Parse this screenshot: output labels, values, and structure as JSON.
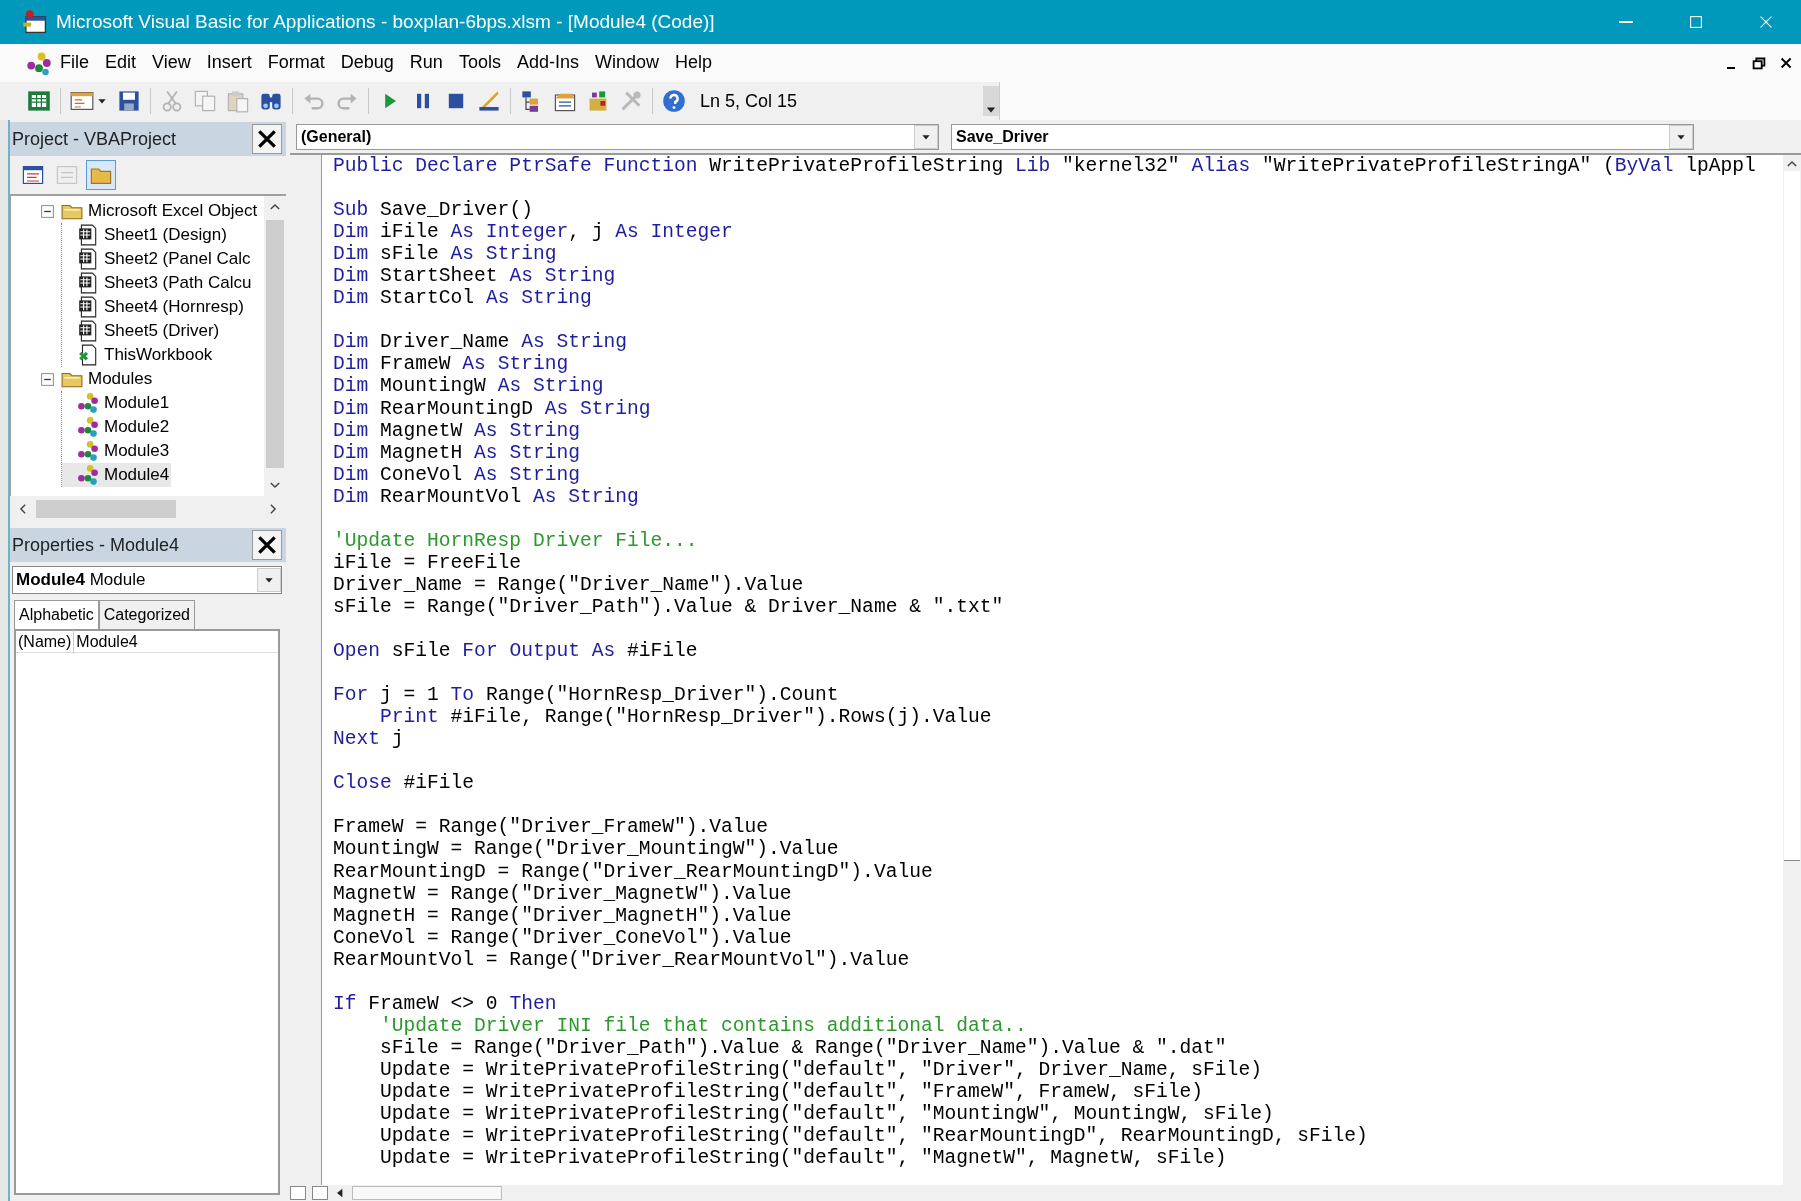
{
  "window": {
    "title": "Microsoft Visual Basic for Applications - boxplan-6bps.xlsm - [Module4 (Code)]"
  },
  "menu": [
    "File",
    "Edit",
    "View",
    "Insert",
    "Format",
    "Debug",
    "Run",
    "Tools",
    "Add-Ins",
    "Window",
    "Help"
  ],
  "toolbar": [
    {
      "kind": "excel",
      "disabled": false
    },
    {
      "kind": "separator"
    },
    {
      "kind": "userform",
      "disabled": false
    },
    {
      "kind": "save",
      "disabled": false
    },
    {
      "kind": "separator"
    },
    {
      "kind": "cut",
      "disabled": true
    },
    {
      "kind": "copy",
      "disabled": true
    },
    {
      "kind": "paste",
      "disabled": true
    },
    {
      "kind": "find",
      "disabled": false
    },
    {
      "kind": "separator"
    },
    {
      "kind": "undo",
      "disabled": true
    },
    {
      "kind": "redo",
      "disabled": true
    },
    {
      "kind": "separator"
    },
    {
      "kind": "run",
      "disabled": false
    },
    {
      "kind": "break",
      "disabled": false
    },
    {
      "kind": "reset",
      "disabled": false
    },
    {
      "kind": "design",
      "disabled": false
    },
    {
      "kind": "separator"
    },
    {
      "kind": "explorer",
      "disabled": false
    },
    {
      "kind": "properties",
      "disabled": false
    },
    {
      "kind": "browser",
      "disabled": false
    },
    {
      "kind": "toolbox",
      "disabled": true
    },
    {
      "kind": "separator"
    },
    {
      "kind": "help",
      "disabled": false
    }
  ],
  "cursor_position": "Ln 5, Col 15",
  "project": {
    "title": "Project - VBAProject",
    "toolbar": [
      {
        "kind": "view_code",
        "disabled": false,
        "pressed": false
      },
      {
        "kind": "view_object",
        "disabled": true,
        "pressed": false
      },
      {
        "kind": "toggle_folders",
        "disabled": false,
        "pressed": true
      }
    ],
    "tree": [
      {
        "label": "Microsoft Excel Object",
        "kind": "folder",
        "expanded": true,
        "selected": false,
        "children": [
          {
            "label": "Sheet1 (Design)",
            "kind": "sheet",
            "selected": false
          },
          {
            "label": "Sheet2 (Panel Calc",
            "kind": "sheet",
            "selected": false
          },
          {
            "label": "Sheet3 (Path Calcu",
            "kind": "sheet",
            "selected": false
          },
          {
            "label": "Sheet4 (Hornresp)",
            "kind": "sheet",
            "selected": false
          },
          {
            "label": "Sheet5 (Driver)",
            "kind": "sheet",
            "selected": false
          },
          {
            "label": "ThisWorkbook",
            "kind": "workbook",
            "selected": false
          }
        ]
      },
      {
        "label": "Modules",
        "kind": "folder",
        "expanded": true,
        "selected": false,
        "children": [
          {
            "label": "Module1",
            "kind": "module",
            "selected": false
          },
          {
            "label": "Module2",
            "kind": "module",
            "selected": false
          },
          {
            "label": "Module3",
            "kind": "module",
            "selected": false
          },
          {
            "label": "Module4",
            "kind": "module",
            "selected": true
          }
        ]
      }
    ]
  },
  "properties": {
    "title": "Properties - Module4",
    "object": "**Module4** Module",
    "tabs": [
      {
        "label": "Alphabetic",
        "selected": true
      },
      {
        "label": "Categorized",
        "selected": false
      }
    ],
    "rows": [
      {
        "name": "(Name)",
        "value": "Module4"
      }
    ]
  },
  "editor": {
    "object": "(General)",
    "procedure": "Save_Driver",
    "lines": [
      {
        "kind": "code",
        "segments": [
          {
            "kind": "keyword",
            "text": "Public Declare PtrSafe Function"
          },
          {
            "kind": "plain",
            "text": " WritePrivateProfileString "
          },
          {
            "kind": "keyword",
            "text": "Lib"
          },
          {
            "kind": "plain",
            "text": " \"kernel32\" "
          },
          {
            "kind": "keyword",
            "text": "Alias"
          },
          {
            "kind": "plain",
            "text": " \"WritePrivateProfileStringA\" ("
          },
          {
            "kind": "keyword",
            "text": "ByVal"
          },
          {
            "kind": "plain",
            "text": " lpAppl"
          }
        ]
      },
      {
        "kind": "blank"
      },
      {
        "kind": "code",
        "segments": [
          {
            "kind": "keyword",
            "text": "Sub"
          },
          {
            "kind": "plain",
            "text": " Save_Driver()"
          }
        ]
      },
      {
        "kind": "code",
        "segments": [
          {
            "kind": "keyword",
            "text": "Dim"
          },
          {
            "kind": "plain",
            "text": " iFile "
          },
          {
            "kind": "keyword",
            "text": "As Integer"
          },
          {
            "kind": "plain",
            "text": ", j "
          },
          {
            "kind": "keyword",
            "text": "As Integer"
          }
        ]
      },
      {
        "kind": "code",
        "segments": [
          {
            "kind": "keyword",
            "text": "Dim"
          },
          {
            "kind": "plain",
            "text": " sFile "
          },
          {
            "kind": "keyword",
            "text": "As String"
          }
        ]
      },
      {
        "kind": "code",
        "segments": [
          {
            "kind": "keyword",
            "text": "Dim"
          },
          {
            "kind": "plain",
            "text": " StartSheet "
          },
          {
            "kind": "keyword",
            "text": "As String"
          }
        ]
      },
      {
        "kind": "code",
        "segments": [
          {
            "kind": "keyword",
            "text": "Dim"
          },
          {
            "kind": "plain",
            "text": " StartCol "
          },
          {
            "kind": "keyword",
            "text": "As String"
          }
        ]
      },
      {
        "kind": "blank"
      },
      {
        "kind": "code",
        "segments": [
          {
            "kind": "keyword",
            "text": "Dim"
          },
          {
            "kind": "plain",
            "text": " Driver_Name "
          },
          {
            "kind": "keyword",
            "text": "As String"
          }
        ]
      },
      {
        "kind": "code",
        "segments": [
          {
            "kind": "keyword",
            "text": "Dim"
          },
          {
            "kind": "plain",
            "text": " FrameW "
          },
          {
            "kind": "keyword",
            "text": "As String"
          }
        ]
      },
      {
        "kind": "code",
        "segments": [
          {
            "kind": "keyword",
            "text": "Dim"
          },
          {
            "kind": "plain",
            "text": " MountingW "
          },
          {
            "kind": "keyword",
            "text": "As String"
          }
        ]
      },
      {
        "kind": "code",
        "segments": [
          {
            "kind": "keyword",
            "text": "Dim"
          },
          {
            "kind": "plain",
            "text": " RearMountingD "
          },
          {
            "kind": "keyword",
            "text": "As String"
          }
        ]
      },
      {
        "kind": "code",
        "segments": [
          {
            "kind": "keyword",
            "text": "Dim"
          },
          {
            "kind": "plain",
            "text": " MagnetW "
          },
          {
            "kind": "keyword",
            "text": "As String"
          }
        ]
      },
      {
        "kind": "code",
        "segments": [
          {
            "kind": "keyword",
            "text": "Dim"
          },
          {
            "kind": "plain",
            "text": " MagnetH "
          },
          {
            "kind": "keyword",
            "text": "As String"
          }
        ]
      },
      {
        "kind": "code",
        "segments": [
          {
            "kind": "keyword",
            "text": "Dim"
          },
          {
            "kind": "plain",
            "text": " ConeVol "
          },
          {
            "kind": "keyword",
            "text": "As String"
          }
        ]
      },
      {
        "kind": "code",
        "segments": [
          {
            "kind": "keyword",
            "text": "Dim"
          },
          {
            "kind": "plain",
            "text": " RearMountVol "
          },
          {
            "kind": "keyword",
            "text": "As String"
          }
        ]
      },
      {
        "kind": "blank"
      },
      {
        "kind": "code",
        "segments": [
          {
            "kind": "comment",
            "text": "'Update HornResp Driver File..."
          }
        ]
      },
      {
        "kind": "code",
        "segments": [
          {
            "kind": "plain",
            "text": "iFile = FreeFile"
          }
        ]
      },
      {
        "kind": "code",
        "segments": [
          {
            "kind": "plain",
            "text": "Driver_Name = Range(\"Driver_Name\").Value"
          }
        ]
      },
      {
        "kind": "code",
        "segments": [
          {
            "kind": "plain",
            "text": "sFile = Range(\"Driver_Path\").Value & Driver_Name & \".txt\""
          }
        ]
      },
      {
        "kind": "blank"
      },
      {
        "kind": "code",
        "segments": [
          {
            "kind": "keyword",
            "text": "Open"
          },
          {
            "kind": "plain",
            "text": " sFile "
          },
          {
            "kind": "keyword",
            "text": "For Output As"
          },
          {
            "kind": "plain",
            "text": " #iFile"
          }
        ]
      },
      {
        "kind": "blank"
      },
      {
        "kind": "code",
        "segments": [
          {
            "kind": "keyword",
            "text": "For"
          },
          {
            "kind": "plain",
            "text": " j = 1 "
          },
          {
            "kind": "keyword",
            "text": "To"
          },
          {
            "kind": "plain",
            "text": " Range(\"HornResp_Driver\").Count"
          }
        ]
      },
      {
        "kind": "code",
        "segments": [
          {
            "kind": "keyword",
            "text": "    Print"
          },
          {
            "kind": "plain",
            "text": " #iFile, Range(\"HornResp_Driver\").Rows(j).Value"
          }
        ]
      },
      {
        "kind": "code",
        "segments": [
          {
            "kind": "keyword",
            "text": "Next"
          },
          {
            "kind": "plain",
            "text": " j"
          }
        ]
      },
      {
        "kind": "blank"
      },
      {
        "kind": "code",
        "segments": [
          {
            "kind": "keyword",
            "text": "Close"
          },
          {
            "kind": "plain",
            "text": " #iFile"
          }
        ]
      },
      {
        "kind": "blank"
      },
      {
        "kind": "code",
        "segments": [
          {
            "kind": "plain",
            "text": "FrameW = Range(\"Driver_FrameW\").Value"
          }
        ]
      },
      {
        "kind": "code",
        "segments": [
          {
            "kind": "plain",
            "text": "MountingW = Range(\"Driver_MountingW\").Value"
          }
        ]
      },
      {
        "kind": "code",
        "segments": [
          {
            "kind": "plain",
            "text": "RearMountingD = Range(\"Driver_RearMountingD\").Value"
          }
        ]
      },
      {
        "kind": "code",
        "segments": [
          {
            "kind": "plain",
            "text": "MagnetW = Range(\"Driver_MagnetW\").Value"
          }
        ]
      },
      {
        "kind": "code",
        "segments": [
          {
            "kind": "plain",
            "text": "MagnetH = Range(\"Driver_MagnetH\").Value"
          }
        ]
      },
      {
        "kind": "code",
        "segments": [
          {
            "kind": "plain",
            "text": "ConeVol = Range(\"Driver_ConeVol\").Value"
          }
        ]
      },
      {
        "kind": "code",
        "segments": [
          {
            "kind": "plain",
            "text": "RearMountVol = Range(\"Driver_RearMountVol\").Value"
          }
        ]
      },
      {
        "kind": "blank"
      },
      {
        "kind": "code",
        "segments": [
          {
            "kind": "keyword",
            "text": "If"
          },
          {
            "kind": "plain",
            "text": " FrameW <> 0 "
          },
          {
            "kind": "keyword",
            "text": "Then"
          }
        ]
      },
      {
        "kind": "code",
        "segments": [
          {
            "kind": "comment",
            "text": "    'Update Driver INI file that contains additional data.."
          }
        ]
      },
      {
        "kind": "code",
        "segments": [
          {
            "kind": "plain",
            "text": "    sFile = Range(\"Driver_Path\").Value & Range(\"Driver_Name\").Value & \".dat\""
          }
        ]
      },
      {
        "kind": "code",
        "segments": [
          {
            "kind": "plain",
            "text": "    Update = WritePrivateProfileString(\"default\", \"Driver\", Driver_Name, sFile)"
          }
        ]
      },
      {
        "kind": "code",
        "segments": [
          {
            "kind": "plain",
            "text": "    Update = WritePrivateProfileString(\"default\", \"FrameW\", FrameW, sFile)"
          }
        ]
      },
      {
        "kind": "code",
        "segments": [
          {
            "kind": "plain",
            "text": "    Update = WritePrivateProfileString(\"default\", \"MountingW\", MountingW, sFile)"
          }
        ]
      },
      {
        "kind": "code",
        "segments": [
          {
            "kind": "plain",
            "text": "    Update = WritePrivateProfileString(\"default\", \"RearMountingD\", RearMountingD, sFile)"
          }
        ]
      },
      {
        "kind": "code",
        "segments": [
          {
            "kind": "plain",
            "text": "    Update = WritePrivateProfileString(\"default\", \"MagnetW\", MagnetW, sFile)"
          }
        ]
      }
    ]
  }
}
